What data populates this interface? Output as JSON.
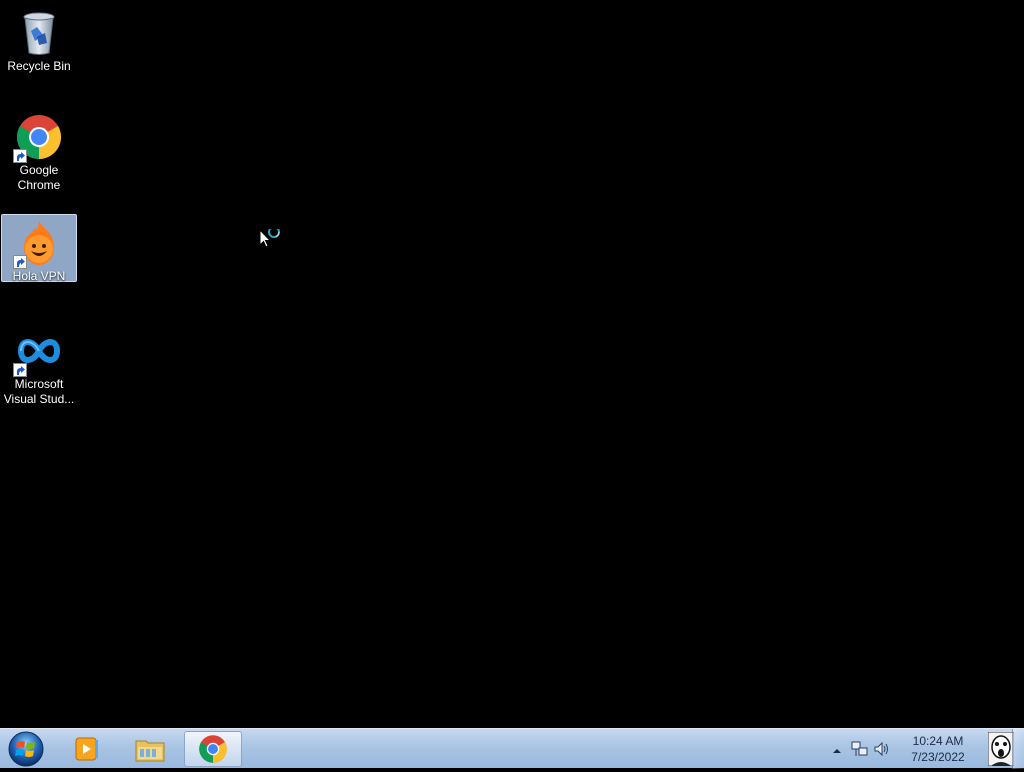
{
  "desktop": {
    "icons": [
      {
        "label": "Recycle Bin",
        "icon": "recycle-bin-icon"
      },
      {
        "label": "Google Chrome",
        "icon": "chrome-icon"
      },
      {
        "label": "Hola VPN",
        "icon": "hola-vpn-icon",
        "selected": true
      },
      {
        "label": "Microsoft Visual Stud...",
        "icon": "visual-studio-icon"
      }
    ]
  },
  "taskbar": {
    "start_icon": "windows-start-icon",
    "pinned": [
      {
        "icon": "media-player-icon"
      },
      {
        "icon": "file-explorer-icon"
      },
      {
        "icon": "chrome-icon",
        "active": true
      }
    ],
    "tray": {
      "icons": [
        "show-hidden-icons-arrow",
        "network-icon",
        "volume-icon"
      ],
      "time": "10:24 AM",
      "date": "7/23/2022"
    }
  },
  "colors": {
    "taskbar_top": "#c6d9ef",
    "taskbar_bottom": "#9ab9df",
    "selection": "#a8c4e6",
    "desktop_bg": "#000000"
  }
}
